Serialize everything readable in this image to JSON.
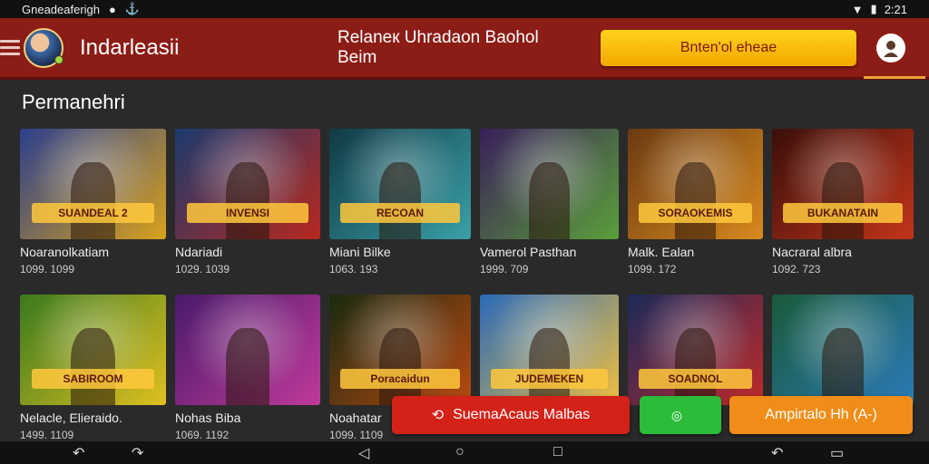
{
  "status_bar": {
    "left_text": "Gneadeaferigh",
    "time": "2:21"
  },
  "app_bar": {
    "title": "Indarleasii",
    "subtitle": "Relaneк Uhradaon Baohol Beim",
    "action_button": "Bnten'ol eheae",
    "accent": "#8c1c16",
    "button_color": "#ffd21e"
  },
  "section": {
    "title": "Permanehri"
  },
  "games": [
    {
      "title": "Noaranolkatiam",
      "meta": "1099. 1099",
      "banner": "SUANDEAL 2",
      "colors": [
        "#2b3f8c",
        "#d9a21c"
      ]
    },
    {
      "title": "Ndariadi",
      "meta": "1029. 1039",
      "banner": "INVENSI",
      "colors": [
        "#1b3a6e",
        "#b8281e"
      ]
    },
    {
      "title": "Miani Bilke",
      "meta": "1063. 193",
      "banner": "RECOAN",
      "colors": [
        "#103a45",
        "#3aa0a8"
      ]
    },
    {
      "title": "Vamerol Pasthan",
      "meta": "1999. 709",
      "banner": "",
      "colors": [
        "#3a1f5a",
        "#5aa03a"
      ]
    },
    {
      "title": "Malk. Ealan",
      "meta": "1099. 172",
      "banner": "SORAOKEMIS",
      "colors": [
        "#6a3a12",
        "#d98a1e"
      ]
    },
    {
      "title": "Nacraral albra",
      "meta": "1092. 723",
      "banner": "BUKANATAIN",
      "colors": [
        "#3a0f0a",
        "#c2341a"
      ]
    },
    {
      "title": "Nelacle, Elieraido.",
      "meta": "1499. 1109",
      "banner": "SABIROOM",
      "colors": [
        "#3a7a1e",
        "#e0c020"
      ]
    },
    {
      "title": "Nohas Biba",
      "meta": "1069. 1192",
      "banner": "",
      "colors": [
        "#4a1a6a",
        "#c03a9a"
      ]
    },
    {
      "title": "Noahatar",
      "meta": "1099. 1109",
      "banner": "Poracaidun",
      "colors": [
        "#1a2a10",
        "#b84a12"
      ]
    },
    {
      "title": "",
      "meta": "",
      "banner": "JUDEMEKEN",
      "colors": [
        "#2a6ab8",
        "#f0c040"
      ]
    },
    {
      "title": "",
      "meta": "",
      "banner": "SOADNOL",
      "colors": [
        "#1a2a5a",
        "#c02a2a"
      ]
    },
    {
      "title": "",
      "meta": "",
      "banner": "",
      "colors": [
        "#1a5a3a",
        "#2a7ab8"
      ]
    }
  ],
  "floating": {
    "red_button": "SuemaAcaus Malbas",
    "green_button": "",
    "orange_button": "Ampirtalo Hh (A-)"
  },
  "nav_icons": [
    "back-icon",
    "back-curve-icon",
    "home-triangle-icon",
    "home-circle-icon",
    "recents-square-icon",
    "back-arrow-icon",
    "window-icon"
  ]
}
